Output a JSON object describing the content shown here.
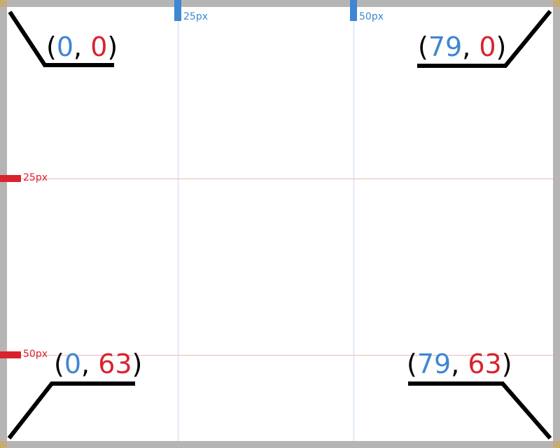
{
  "colors": {
    "border": "#b5b5b5",
    "x_accent": "#3f86d3",
    "y_accent": "#d9232e",
    "bracket": "#000000"
  },
  "ruler": {
    "x_marks": [
      "25px",
      "50px"
    ],
    "y_marks": [
      "25px",
      "50px"
    ]
  },
  "corners": {
    "top_left": {
      "x": "0",
      "y": "0"
    },
    "top_right": {
      "x": "79",
      "y": "0"
    },
    "bottom_left": {
      "x": "0",
      "y": "63"
    },
    "bottom_right": {
      "x": "79",
      "y": "63"
    }
  }
}
